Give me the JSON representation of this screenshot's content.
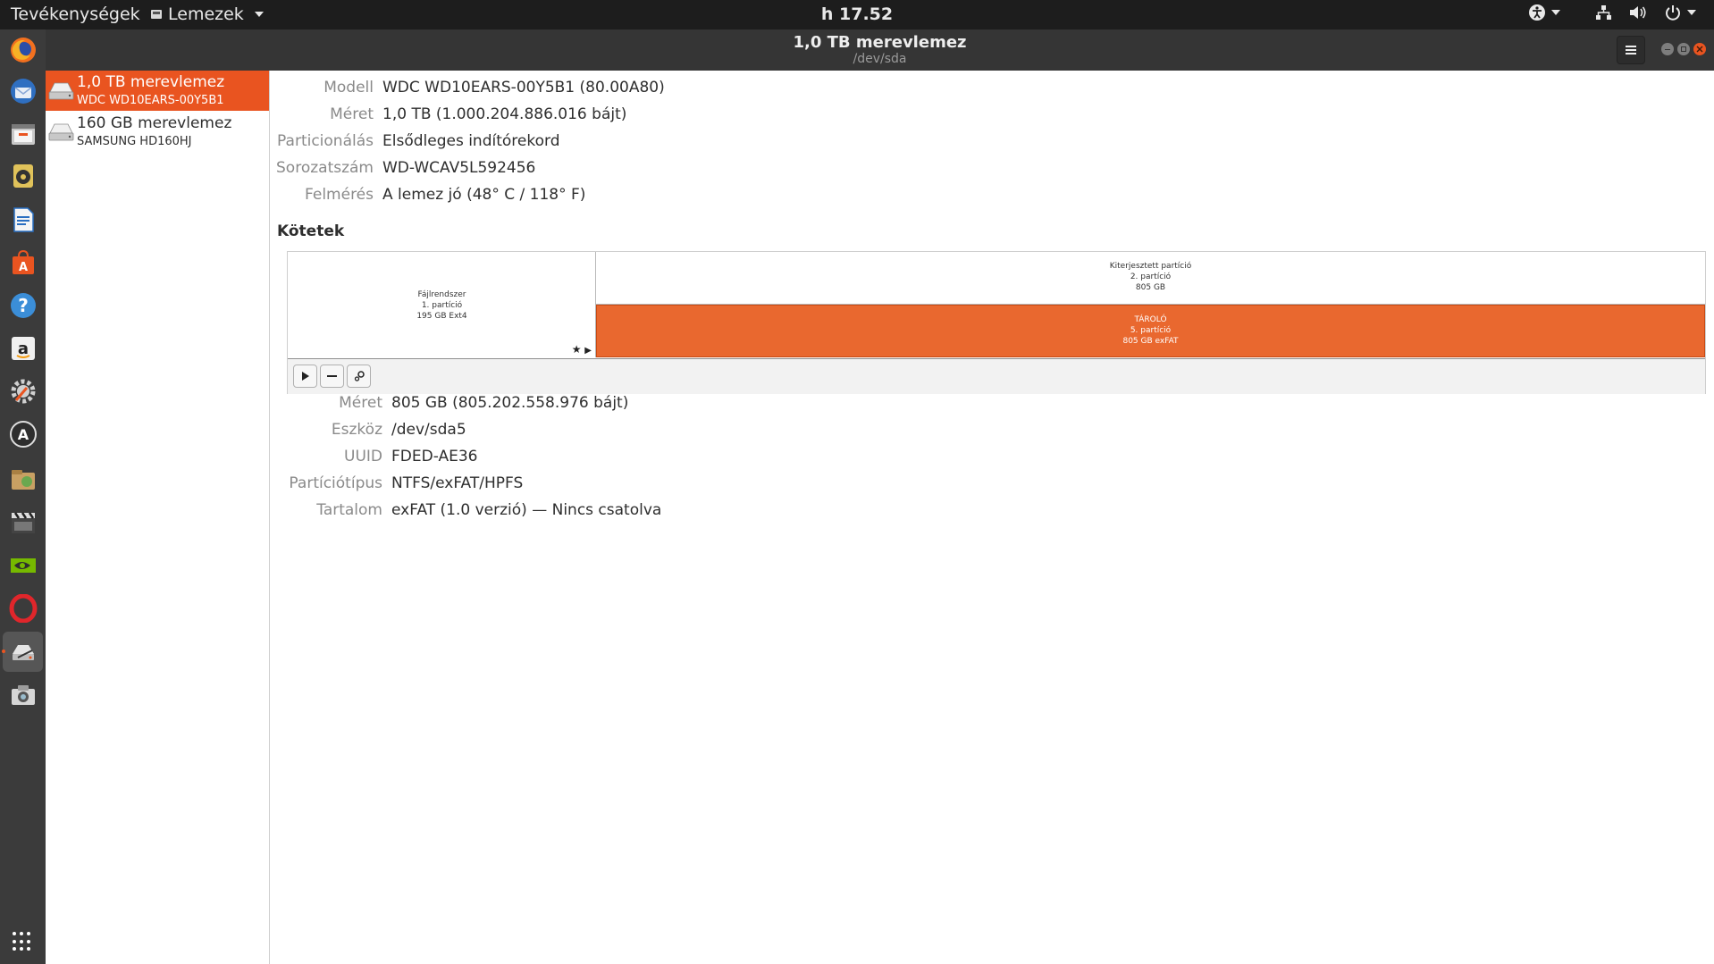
{
  "topbar": {
    "activities": "Tevékenységek",
    "app_menu": "Lemezek",
    "clock": "h 17.52"
  },
  "window": {
    "title": "1,0 TB merevlemez",
    "subtitle": "/dev/sda"
  },
  "drives": [
    {
      "name": "1,0 TB merevlemez",
      "model": "WDC WD10EARS-00Y5B1",
      "selected": true
    },
    {
      "name": "160 GB merevlemez",
      "model": "SAMSUNG HD160HJ",
      "selected": false
    }
  ],
  "disk_info": [
    {
      "label": "Modell",
      "value": "WDC WD10EARS-00Y5B1 (80.00A80)"
    },
    {
      "label": "Méret",
      "value": "1,0 TB (1.000.204.886.016 bájt)"
    },
    {
      "label": "Particionálás",
      "value": "Elsődleges indítórekord"
    },
    {
      "label": "Sorozatszám",
      "value": "WD-WCAV5L592456"
    },
    {
      "label": "Felmérés",
      "value": "A lemez jó (48° C / 118° F)"
    }
  ],
  "volumes": {
    "heading": "Kötetek",
    "filesystem": {
      "line1": "Fájlrendszer",
      "line2": "1. partíció",
      "line3": "195 GB Ext4"
    },
    "extended": {
      "line1": "Kiterjesztett partíció",
      "line2": "2. partíció",
      "line3": "805 GB"
    },
    "storage": {
      "line1": "TÁROLÓ",
      "line2": "5. partíció",
      "line3": "805 GB exFAT"
    }
  },
  "volume_info": [
    {
      "label": "Méret",
      "value": "805 GB (805.202.558.976 bájt)"
    },
    {
      "label": "Eszköz",
      "value": "/dev/sda5"
    },
    {
      "label": "UUID",
      "value": "FDED-AE36"
    },
    {
      "label": "Partíciótípus",
      "value": "NTFS/exFAT/HPFS"
    },
    {
      "label": "Tartalom",
      "value": "exFAT (1.0 verzió) — Nincs csatolva"
    }
  ],
  "colors": {
    "accent": "#e95420",
    "topbar": "#1d1d1d",
    "dock": "#3b3b3b",
    "headerbar": "#353535"
  },
  "dock_icons": [
    "firefox-icon",
    "thunderbird-icon",
    "files-icon",
    "rhythmbox-icon",
    "writer-icon",
    "software-icon",
    "help-icon",
    "amazon-icon",
    "settings-icon",
    "updater-icon",
    "archive-icon",
    "video-editor-icon",
    "nvidia-icon",
    "opera-icon",
    "disks-icon",
    "camera-icon"
  ]
}
